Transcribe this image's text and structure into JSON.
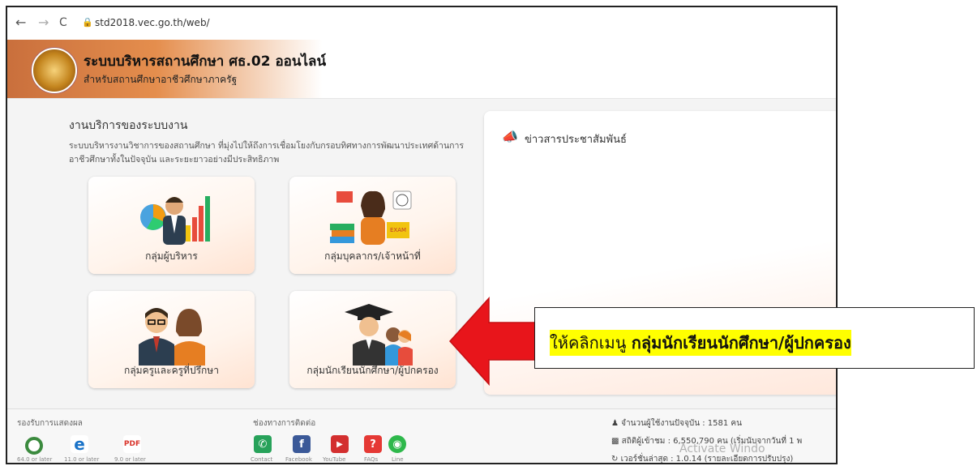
{
  "browser": {
    "back": "←",
    "forward": "→",
    "reload": "C",
    "url": "std2018.vec.go.th/web/"
  },
  "header": {
    "title": "ระบบบริหารสถานศึกษา ศธ.02 ออนไลน์",
    "subtitle": "สำหรับสถานศึกษาอาชีวศึกษาภาครัฐ"
  },
  "services": {
    "title": "งานบริการของระบบงาน",
    "desc": "ระบบบริหารงานวิชาการของสถานศึกษา ที่มุ่งไปให้ถึงการเชื่อมโยงกับกรอบทิศทางการพัฒนาประเทศด้านการอาชีวศึกษาทั้งในปัจจุบัน และระยะยาวอย่างมีประสิทธิภาพ",
    "cards": [
      {
        "label": "กลุ่มผู้บริหาร"
      },
      {
        "label": "กลุ่มบุคลากร/เจ้าหน้าที่"
      },
      {
        "label": "กลุ่มครูและครูที่ปรึกษา"
      },
      {
        "label": "กลุ่มนักเรียนนักศึกษา/ผู้ปกครอง"
      }
    ]
  },
  "news": {
    "title": "ข่าวสารประชาสัมพันธ์"
  },
  "footer": {
    "support_title": "รองรับการแสดงผล",
    "browsers": [
      {
        "name": "chrome-icon",
        "caption": "64.0 or later",
        "color": "#3b8a3e"
      },
      {
        "name": "ie-icon",
        "caption": "11.0 or later",
        "color": "#1a73c8"
      },
      {
        "name": "pdf-icon",
        "caption": "9.0 or later",
        "color": "#d9342b"
      }
    ],
    "contact_title": "ช่องทางการติดต่อ",
    "contacts": [
      {
        "caption": "Contact",
        "color": "#27a25a",
        "glyph": "✆"
      },
      {
        "caption": "Facebook",
        "color": "#3b5998",
        "glyph": "f"
      },
      {
        "caption": "YouTube",
        "color": "#d32f2f",
        "glyph": "▶"
      },
      {
        "caption": "FAQs",
        "color": "#e53935",
        "glyph": "?"
      },
      {
        "caption": "Line",
        "color": "#2eb84b",
        "glyph": "◉"
      }
    ],
    "stats": {
      "online": "จำนวนผู้ใช้งานปัจจุบัน : 1581 คน",
      "visitors": "สถิติผู้เข้าชม : 6,550,790 คน (เริ่มนับจากวันที่ 1 พ",
      "version": "เวอร์ชั่นล่าสุด : 1.0.14 (รายละเอียดการปรับปรุง)"
    },
    "watermark": "Activate Windo"
  },
  "callout": {
    "prefix": "ให้คลิกเมนู ",
    "bold": "กลุ่มนักเรียนนักศึกษา/ผู้ปกครอง"
  },
  "colors": {
    "arrow": "#e8151b",
    "highlight": "#ffff00"
  }
}
